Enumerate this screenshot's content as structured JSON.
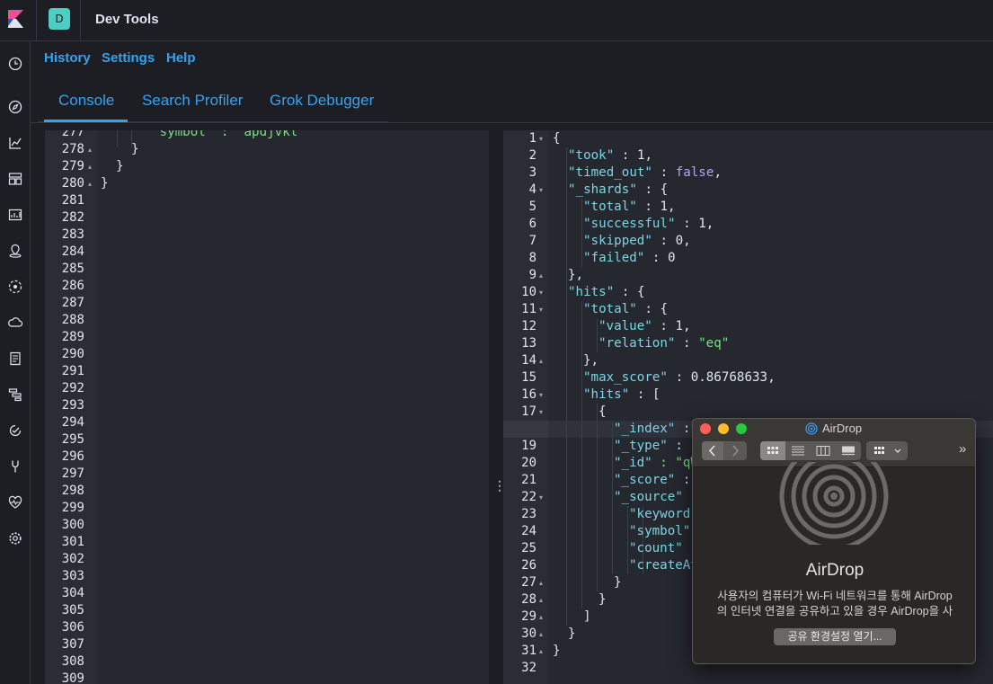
{
  "header": {
    "space_initial": "D",
    "app_title": "Dev Tools"
  },
  "nav_icons": [
    "clock-icon",
    "compass-icon",
    "chart-icon",
    "dashboard-icon",
    "canvas-icon",
    "map-icon",
    "ml-icon",
    "cloud-icon",
    "logs-icon",
    "apm-icon",
    "uptime-icon",
    "devtools-icon",
    "heartbeat-icon",
    "gear-icon"
  ],
  "subnav": {
    "history": "History",
    "settings": "Settings",
    "help": "Help"
  },
  "tabs": [
    {
      "label": "Console"
    },
    {
      "label": "Search Profiler"
    },
    {
      "label": "Grok Debugger"
    }
  ],
  "left_editor": {
    "line_numbers": [
      "277",
      "278",
      "279",
      "280",
      "281",
      "282",
      "283",
      "284",
      "285",
      "286",
      "287",
      "288",
      "289",
      "290",
      "291",
      "292",
      "293",
      "294",
      "295",
      "296",
      "297",
      "298",
      "299",
      "300",
      "301",
      "302",
      "303",
      "304",
      "305",
      "306",
      "307",
      "308",
      "309"
    ],
    "folds": {
      "278": "▴",
      "279": "▴",
      "280": "▴"
    },
    "code": {
      "l277": "\"symbol\" : \"apdjvkl\"",
      "l278": "}",
      "l279": "}",
      "l280": "}"
    }
  },
  "right_editor": {
    "line_numbers": [
      "1",
      "2",
      "3",
      "4",
      "5",
      "6",
      "7",
      "8",
      "9",
      "10",
      "11",
      "12",
      "13",
      "14",
      "15",
      "16",
      "17",
      "18",
      "19",
      "20",
      "21",
      "22",
      "23",
      "24",
      "25",
      "26",
      "27",
      "28",
      "29",
      "30",
      "31",
      "32"
    ],
    "folds": {
      "1": "▾",
      "4": "▾",
      "9": "▴",
      "10": "▾",
      "11": "▾",
      "14": "▴",
      "16": "▾",
      "17": "▾",
      "22": "▾",
      "27": "▴",
      "28": "▴",
      "29": "▴",
      "30": "▴",
      "31": "▴"
    },
    "lines": {
      "l1": "{",
      "l2_key": "\"took\"",
      "l2_val": "1",
      "l3_key": "\"timed_out\"",
      "l3_val": "false",
      "l4_key": "\"_shards\"",
      "l4_val": "{",
      "l5_key": "\"total\"",
      "l5_val": "1",
      "l6_key": "\"successful\"",
      "l6_val": "1",
      "l7_key": "\"skipped\"",
      "l7_val": "0",
      "l8_key": "\"failed\"",
      "l8_val": "0",
      "l9": "},",
      "l10_key": "\"hits\"",
      "l10_val": "{",
      "l11_key": "\"total\"",
      "l11_val": "{",
      "l12_key": "\"value\"",
      "l12_val": "1",
      "l13_key": "\"relation\"",
      "l13_val": "\"eq\"",
      "l14": "},",
      "l15_key": "\"max_score\"",
      "l15_val": "0.86768633",
      "l16_key": "\"hits\"",
      "l16_val": "[",
      "l17": "{",
      "l18_key": "\"_index\"",
      "l18_rest": " : ",
      "l19_key": "\"_type\"",
      "l19_rest": " : \"",
      "l20_key": "\"_id\"",
      "l20_rest": " : \"qW",
      "l21_key": "\"_score\"",
      "l21_rest": " : ",
      "l22_key": "\"_source\"",
      "l22_rest": " :",
      "l23_key": "\"keyword\"",
      "l24_key": "\"symbol\"",
      "l25_key": "\"count\"",
      "l25_rest": " :",
      "l26_key": "\"createAt",
      "l27": "}",
      "l28": "}",
      "l29": "]",
      "l30": "}",
      "l31": "}"
    }
  },
  "airdrop": {
    "window_title": "AirDrop",
    "heading": "AirDrop",
    "desc_line1": "사용자의 컴퓨터가 Wi-Fi 네트워크를 통해 AirDrop",
    "desc_line2": "의 인터넷 연결을 공유하고 있을 경우 AirDrop을 사",
    "button": "공유 환경설정 열기...",
    "more": "»",
    "colors": {
      "close": "#ff5f57",
      "minimize": "#febc2e",
      "zoom": "#28c840"
    }
  }
}
